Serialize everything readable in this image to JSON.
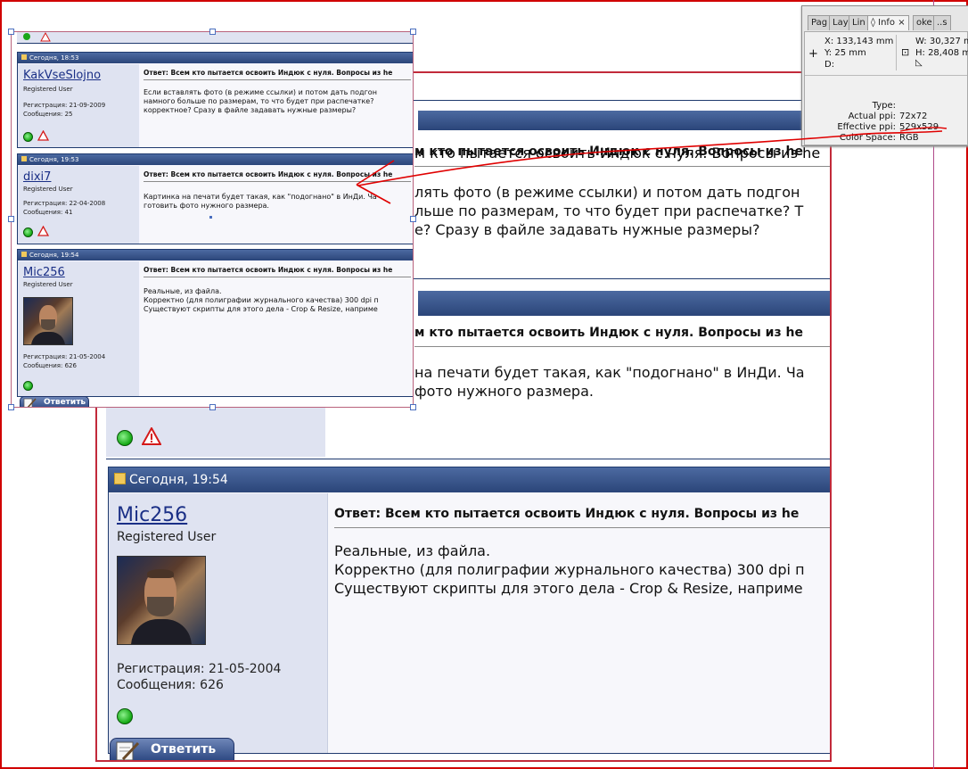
{
  "big_image": {
    "thread_title_cut": "м кто пытается освоить Индюк с нуля. Вопросы из he",
    "post_a_body": [
      "лять фото (в режиме ссылки) и потом дать подгон",
      "льше по размерам, то что будет при распечатке? Т",
      "е? Сразу в файле задавать нужные размеры?"
    ],
    "post_b_body": [
      "на печати будет такая, как \"подогнано\" в ИнДи. Ча",
      "фото нужного размера."
    ],
    "post_c": {
      "date": "Сегодня, 19:54",
      "username": "Mic256",
      "role": "Registered User",
      "reg": "Регистрация: 21-05-2004",
      "msgs": "Сообщения: 626",
      "title": "Ответ: Всем кто пытается освоить Индюк с нуля. Вопросы из he",
      "body": [
        "Реальные, из файла.",
        "Корректно (для полиграфии журнального качества) 300 dpi п",
        "Существуют скрипты для этого дела - Crop & Resize, наприме"
      ]
    },
    "reply_button": "Ответить"
  },
  "small_image": {
    "top_icons_hint": "",
    "posts": [
      {
        "date": "Сегодня, 18:53",
        "username": "KakVseSlojno",
        "role": "Registered User",
        "reg": "Регистрация: 21-09-2009",
        "msgs": "Сообщения: 25",
        "title": "Ответ: Всем кто пытается освоить Индюк с нуля. Вопросы из he",
        "body": [
          "Если вставлять фото (в режиме ссылки) и потом дать подгон",
          "намного больше по размерам, то что будет при распечатке?",
          "корректное? Сразу в файле задавать нужные размеры?"
        ]
      },
      {
        "date": "Сегодня, 19:53",
        "username": "dixi7",
        "role": "Registered User",
        "reg": "Регистрация: 22-04-2008",
        "msgs": "Сообщения: 41",
        "title": "Ответ: Всем кто пытается освоить Индюк с нуля. Вопросы из he",
        "body": [
          "Картинка на печати будет такая, как \"подогнано\" в ИнДи. Ча",
          "готовить фото нужного размера."
        ]
      },
      {
        "date": "Сегодня, 19:54",
        "username": "Mic256",
        "role": "Registered User",
        "reg": "Регистрация: 21-05-2004",
        "msgs": "Сообщения: 626",
        "title": "Ответ: Всем кто пытается освоить Индюк с нуля. Вопросы из he",
        "body": [
          "Реальные, из файла.",
          "Корректно (для полиграфии журнального качества) 300 dpi п",
          "Существуют скрипты для этого дела - Crop & Resize, наприме"
        ]
      }
    ],
    "reply_button": "Ответить"
  },
  "info_panel": {
    "tabs": [
      "Pag",
      "Lay",
      "Lin",
      "◊ Info",
      "×",
      "oke",
      "..s"
    ],
    "x": "X: 133,143 mm",
    "y": "Y: 25 mm",
    "d": "D:",
    "w": "W: 30,327 m",
    "h": "H: 28,408 m",
    "type_label": "Type:",
    "actual_label": "Actual ppi:",
    "actual_value": "72x72",
    "effective_label": "Effective ppi:",
    "effective_value": "529x529",
    "colorspace_label": "Color Space:",
    "colorspace_value": "RGB"
  },
  "colors": {
    "frame_red": "#d00000",
    "annotation_red": "#e00000",
    "header_blue": "#2b4579",
    "username_blue": "#1a2f86"
  }
}
